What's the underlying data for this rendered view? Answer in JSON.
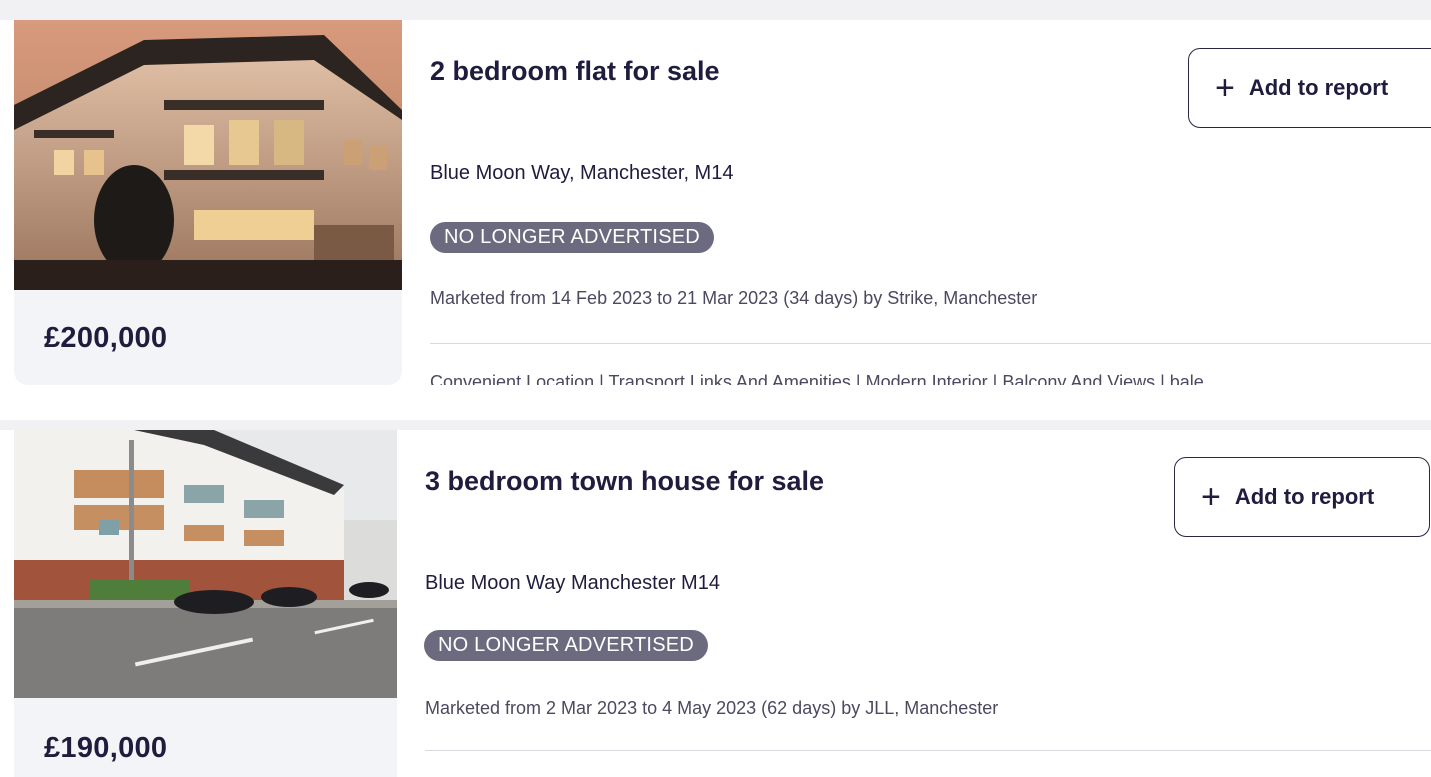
{
  "listings": [
    {
      "price": "£200,000",
      "title": "2 bedroom flat for sale",
      "add_button_label": "Add to report",
      "address": "Blue Moon Way, Manchester, M14",
      "status_badge": "NO LONGER ADVERTISED",
      "marketed": "Marketed from 14 Feb 2023 to 21 Mar 2023 (34 days) by Strike, Manchester",
      "features": "Convenient Location | Transport Links And Amenities | Modern Interior | Balcony And Views | bale"
    },
    {
      "price": "£190,000",
      "title": "3 bedroom town house for sale",
      "add_button_label": "Add to report",
      "address": "Blue Moon Way Manchester M14",
      "status_badge": "NO LONGER ADVERTISED",
      "marketed": "Marketed from 2 Mar 2023 to 4 May 2023 (62 days) by JLL, Manchester"
    }
  ],
  "icons": {
    "add": "plus-icon"
  },
  "colors": {
    "text": "#1f1c3e",
    "badge_bg": "#6c6a7f",
    "muted": "#4b4960",
    "card_bg": "#f3f4f7"
  }
}
